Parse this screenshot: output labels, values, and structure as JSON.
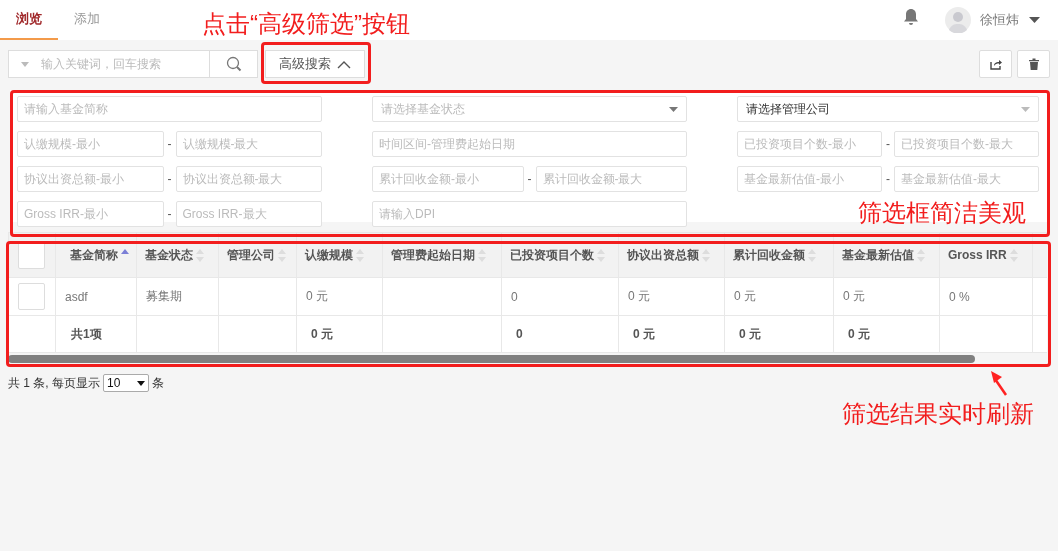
{
  "header": {
    "tabs": [
      {
        "label": "浏览",
        "selected": true
      },
      {
        "label": "添加",
        "selected": false
      }
    ],
    "user": {
      "name": "徐恒炜"
    }
  },
  "toolbar": {
    "search": {
      "placeholder": "输入关键词，回车搜索"
    },
    "advanced_button": {
      "label": "高级搜索",
      "expanded": true
    }
  },
  "filters": {
    "rows": [
      [
        {
          "kind": "text",
          "placeholder": "请输入基金简称"
        },
        {
          "kind": "select",
          "placeholder": "请选择基金状态"
        },
        {
          "kind": "select",
          "value": "请选择管理公司"
        }
      ],
      [
        {
          "kind": "range",
          "fields": [
            {
              "placeholder": "认缴规模-最小"
            },
            {
              "placeholder": "认缴规模-最大"
            }
          ],
          "separator": "-"
        },
        {
          "kind": "text",
          "placeholder": "时间区间-管理费起始日期"
        },
        {
          "kind": "range",
          "fields": [
            {
              "placeholder": "已投资项目个数-最小"
            },
            {
              "placeholder": "已投资项目个数-最大"
            }
          ],
          "separator": "-"
        }
      ],
      [
        {
          "kind": "range",
          "fields": [
            {
              "placeholder": "协议出资总额-最小"
            },
            {
              "placeholder": "协议出资总额-最大"
            }
          ],
          "separator": "-"
        },
        {
          "kind": "range",
          "fields": [
            {
              "placeholder": "累计回收金额-最小"
            },
            {
              "placeholder": "累计回收金额-最大"
            }
          ],
          "separator": "-"
        },
        {
          "kind": "range",
          "fields": [
            {
              "placeholder": "基金最新估值-最小"
            },
            {
              "placeholder": "基金最新估值-最大"
            }
          ],
          "separator": "-"
        }
      ],
      [
        {
          "kind": "range",
          "fields": [
            {
              "placeholder": "Gross IRR-最小"
            },
            {
              "placeholder": "Gross IRR-最大"
            }
          ],
          "separator": "-"
        },
        {
          "kind": "text",
          "placeholder": "请输入DPI"
        }
      ]
    ]
  },
  "table": {
    "all_checked": false,
    "columns": [
      {
        "label": "基金简称",
        "sorted": true
      },
      {
        "label": "基金状态",
        "sorted": false
      },
      {
        "label": "管理公司",
        "sorted": false
      },
      {
        "label": "认缴规模",
        "sorted": false
      },
      {
        "label": "管理费起始日期",
        "sorted": false
      },
      {
        "label": "已投资项目个数",
        "sorted": false
      },
      {
        "label": "协议出资总额",
        "sorted": false
      },
      {
        "label": "累计回收金额",
        "sorted": false
      },
      {
        "label": "基金最新估值",
        "sorted": false
      },
      {
        "label": "Gross IRR",
        "sorted": false
      }
    ],
    "rows": [
      {
        "checked": false,
        "name": "asdf",
        "status": "募集期",
        "committed": "0 元",
        "projects": "0",
        "agreed": "0 元",
        "recovered": "0 元",
        "valuation": "0 元",
        "gross_irr": "0 %"
      }
    ],
    "summary": {
      "name": "共1项",
      "committed": "0 元",
      "projects": "0",
      "agreed": "0 元",
      "recovered": "0 元",
      "valuation": "0 元"
    }
  },
  "pagination": {
    "total_text": "共 1 条, 每页显示",
    "page_size": "10",
    "unit": "条"
  },
  "annotations": {
    "button_note": "点击“高级筛选”按钮",
    "filter_note": "筛选框简洁美观",
    "table_note": "筛选结果实时刷新"
  }
}
